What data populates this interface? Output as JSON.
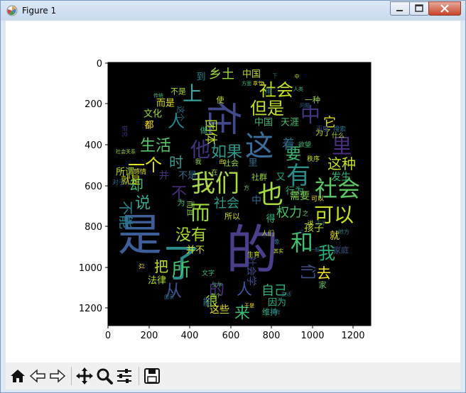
{
  "window": {
    "title": "Figure 1"
  },
  "axes": {
    "x_ticks": [
      "0",
      "200",
      "400",
      "600",
      "800",
      "1000",
      "1200"
    ],
    "y_ticks": [
      "0",
      "200",
      "400",
      "600",
      "800",
      "1000",
      "1200"
    ]
  },
  "wordcloud": [
    {
      "t": "的",
      "x": 354,
      "y": 352,
      "s": 74,
      "c": "#4b3f8c",
      "r": 0
    },
    {
      "t": "是",
      "x": 196,
      "y": 330,
      "s": 62,
      "c": "#3e5e9a",
      "r": 0
    },
    {
      "t": "了",
      "x": 255,
      "y": 370,
      "s": 54,
      "c": "#2a8a8b",
      "r": 0
    },
    {
      "t": "在",
      "x": 313,
      "y": 166,
      "s": 50,
      "c": "#434a8c",
      "r": 90
    },
    {
      "t": "这",
      "x": 364,
      "y": 205,
      "s": 40,
      "c": "#3a6f9b",
      "r": 0
    },
    {
      "t": "我们",
      "x": 302,
      "y": 258,
      "s": 34,
      "c": "#a7d94a",
      "r": 0
    },
    {
      "t": "也",
      "x": 380,
      "y": 274,
      "s": 36,
      "c": "#a5db3e",
      "r": 0
    },
    {
      "t": "社会",
      "x": 474,
      "y": 265,
      "s": 32,
      "c": "#5cc863",
      "r": 0
    },
    {
      "t": "有",
      "x": 419,
      "y": 247,
      "s": 34,
      "c": "#2a8d8a",
      "r": 0
    },
    {
      "t": "可以",
      "x": 469,
      "y": 302,
      "s": 28,
      "c": "#c8e020",
      "r": 0
    },
    {
      "t": "和",
      "x": 424,
      "y": 341,
      "s": 32,
      "c": "#43bf71",
      "r": 0
    },
    {
      "t": "而",
      "x": 281,
      "y": 299,
      "s": 28,
      "c": "#9bd93b",
      "r": 0
    },
    {
      "t": "上",
      "x": 270,
      "y": 131,
      "s": 28,
      "c": "#37a7a0",
      "r": 0
    },
    {
      "t": "社会",
      "x": 388,
      "y": 126,
      "s": 24,
      "c": "#c6e121",
      "r": 0
    },
    {
      "t": "中",
      "x": 436,
      "y": 161,
      "s": 28,
      "c": "#463480",
      "r": 0
    },
    {
      "t": "但是",
      "x": 375,
      "y": 152,
      "s": 24,
      "c": "#c1df2a",
      "r": 0
    },
    {
      "t": "里",
      "x": 480,
      "y": 205,
      "s": 28,
      "c": "#4b2f7f",
      "r": 0
    },
    {
      "t": "他",
      "x": 281,
      "y": 210,
      "s": 28,
      "c": "#46337f",
      "r": 0
    },
    {
      "t": "如果",
      "x": 318,
      "y": 214,
      "s": 22,
      "c": "#2f9a8a",
      "r": 0
    },
    {
      "t": "生活",
      "x": 218,
      "y": 205,
      "s": 22,
      "c": "#56c667",
      "r": 0
    },
    {
      "t": "一个",
      "x": 203,
      "y": 232,
      "s": 24,
      "c": "#e0e324",
      "r": 0
    },
    {
      "t": "时",
      "x": 247,
      "y": 228,
      "s": 20,
      "c": "#3a9d90",
      "r": 0
    },
    {
      "t": "人",
      "x": 247,
      "y": 170,
      "s": 24,
      "c": "#25848e",
      "r": 0
    },
    {
      "t": "没有",
      "x": 268,
      "y": 331,
      "s": 22,
      "c": "#aadc32",
      "r": 0
    },
    {
      "t": "所",
      "x": 254,
      "y": 380,
      "s": 26,
      "c": "#4ac16d",
      "r": 0
    },
    {
      "t": "从",
      "x": 243,
      "y": 409,
      "s": 24,
      "c": "#3b518b",
      "r": 0
    },
    {
      "t": "我",
      "x": 459,
      "y": 356,
      "s": 24,
      "c": "#2ab07f",
      "r": 0
    },
    {
      "t": "要",
      "x": 412,
      "y": 217,
      "s": 22,
      "c": "#3fbc73",
      "r": 0
    },
    {
      "t": "这种",
      "x": 480,
      "y": 230,
      "s": 20,
      "c": "#c2df23",
      "r": 0
    },
    {
      "t": "说",
      "x": 200,
      "y": 286,
      "s": 22,
      "c": "#3ba991",
      "r": 0
    },
    {
      "t": "却",
      "x": 191,
      "y": 260,
      "s": 20,
      "c": "#3fbc73",
      "r": 0
    },
    {
      "t": "不能",
      "x": 176,
      "y": 302,
      "s": 20,
      "c": "#25848e",
      "r": 90
    },
    {
      "t": "不",
      "x": 251,
      "y": 272,
      "s": 22,
      "c": "#472c7a",
      "r": 0
    },
    {
      "t": "权力",
      "x": 406,
      "y": 299,
      "s": 18,
      "c": "#4cc26c",
      "r": 0
    },
    {
      "t": "社会",
      "x": 318,
      "y": 286,
      "s": 18,
      "c": "#2b9a8a",
      "r": 0
    },
    {
      "t": "自己",
      "x": 385,
      "y": 409,
      "s": 18,
      "c": "#2fb47c",
      "r": 0
    },
    {
      "t": "去",
      "x": 455,
      "y": 384,
      "s": 20,
      "c": "#fde725",
      "r": 0
    },
    {
      "t": "们",
      "x": 431,
      "y": 382,
      "s": 22,
      "c": "#3d4e8a",
      "r": 90
    },
    {
      "t": "人",
      "x": 343,
      "y": 408,
      "s": 22,
      "c": "#3a539b",
      "r": 0
    },
    {
      "t": "的",
      "x": 304,
      "y": 408,
      "s": 22,
      "c": "#46317e",
      "r": 0
    },
    {
      "t": "来",
      "x": 340,
      "y": 441,
      "s": 22,
      "c": "#3fbc73",
      "r": 0
    },
    {
      "t": "把",
      "x": 226,
      "y": 375,
      "s": 20,
      "c": "#c8e020",
      "r": 0
    },
    {
      "t": "很",
      "x": 297,
      "y": 425,
      "s": 18,
      "c": "#a0da39",
      "r": 0
    },
    {
      "t": "发生",
      "x": 479,
      "y": 249,
      "s": 14,
      "c": "#34b679",
      "r": 0
    },
    {
      "t": "行为",
      "x": 414,
      "y": 269,
      "s": 13,
      "c": "#28ae80",
      "r": 0
    },
    {
      "t": "孩子",
      "x": 441,
      "y": 321,
      "s": 14,
      "c": "#b5de2b",
      "r": 0
    },
    {
      "t": "乡土",
      "x": 311,
      "y": 104,
      "s": 18,
      "c": "#9fda3a",
      "r": 0
    },
    {
      "t": "中国",
      "x": 353,
      "y": 104,
      "s": 13,
      "c": "#b2dd2d",
      "r": 0
    },
    {
      "t": "团体",
      "x": 295,
      "y": 185,
      "s": 18,
      "c": "#b8de29",
      "r": 90
    },
    {
      "t": "它",
      "x": 463,
      "y": 172,
      "s": 18,
      "c": "#e5e419",
      "r": 0
    },
    {
      "t": "着",
      "x": 405,
      "y": 203,
      "s": 18,
      "c": "#2e6e8e",
      "r": 0
    },
    {
      "t": "需要",
      "x": 421,
      "y": 276,
      "s": 14,
      "c": "#7ad151",
      "r": 0
    },
    {
      "t": "社会学",
      "x": 352,
      "y": 381,
      "s": 14,
      "c": "#3e4a89",
      "r": 90
    },
    {
      "t": "因为",
      "x": 389,
      "y": 426,
      "s": 13,
      "c": "#25ab82",
      "r": 0
    },
    {
      "t": "这些",
      "x": 308,
      "y": 436,
      "s": 14,
      "c": "#e1e21f",
      "r": 0
    },
    {
      "t": "法律",
      "x": 220,
      "y": 395,
      "s": 13,
      "c": "#b2dd2d",
      "r": 0
    },
    {
      "t": "就是",
      "x": 183,
      "y": 254,
      "s": 14,
      "c": "#d8e219",
      "r": 0
    },
    {
      "t": "所谓",
      "x": 175,
      "y": 242,
      "s": 13,
      "c": "#c0df25",
      "r": 0
    },
    {
      "t": "文化",
      "x": 214,
      "y": 160,
      "s": 13,
      "c": "#95d840",
      "r": 0
    },
    {
      "t": "而是",
      "x": 232,
      "y": 145,
      "s": 13,
      "c": "#e5e419",
      "r": 0
    },
    {
      "t": "都",
      "x": 209,
      "y": 176,
      "s": 13,
      "c": "#fde725",
      "r": 0
    },
    {
      "t": "中国",
      "x": 370,
      "y": 172,
      "s": 13,
      "c": "#46b66f",
      "r": 0
    },
    {
      "t": "天涯",
      "x": 407,
      "y": 172,
      "s": 13,
      "c": "#4ac16d",
      "r": 0
    },
    {
      "t": "为了",
      "x": 454,
      "y": 186,
      "s": 11,
      "c": "#c8e020",
      "r": 0
    },
    {
      "t": "搜索",
      "x": 477,
      "y": 182,
      "s": 9,
      "c": "#2c728e",
      "r": 0
    },
    {
      "t": "欲望",
      "x": 428,
      "y": 204,
      "s": 9,
      "c": "#3aba76",
      "r": 0
    },
    {
      "t": "秩序",
      "x": 440,
      "y": 224,
      "s": 9,
      "c": "#c8e020",
      "r": 0
    },
    {
      "t": "社群",
      "x": 364,
      "y": 249,
      "s": 11,
      "c": "#90d743",
      "r": 0
    },
    {
      "t": "又",
      "x": 394,
      "y": 249,
      "s": 13,
      "c": "#29af7f",
      "r": 0
    },
    {
      "t": "就",
      "x": 470,
      "y": 332,
      "s": 14,
      "c": "#e7e419",
      "r": 0
    },
    {
      "t": "家庭",
      "x": 479,
      "y": 352,
      "s": 11,
      "c": "#3b528b",
      "r": 0
    },
    {
      "t": "家",
      "x": 453,
      "y": 401,
      "s": 11,
      "c": "#5ec962",
      "r": 0
    },
    {
      "t": "中",
      "x": 360,
      "y": 282,
      "s": 14,
      "c": "#2f6b8e",
      "r": 0
    },
    {
      "t": "得",
      "x": 380,
      "y": 308,
      "s": 13,
      "c": "#35b779",
      "r": 0
    },
    {
      "t": "所以",
      "x": 326,
      "y": 304,
      "s": 11,
      "c": "#d2e21b",
      "r": 0
    },
    {
      "t": "人们",
      "x": 376,
      "y": 329,
      "s": 9,
      "c": "#b5de2b",
      "r": 0
    },
    {
      "t": "并",
      "x": 230,
      "y": 247,
      "s": 14,
      "c": "#46327e",
      "r": 0
    },
    {
      "t": "不是",
      "x": 263,
      "y": 247,
      "s": 13,
      "c": "#31688e",
      "r": 0
    },
    {
      "t": "而且",
      "x": 267,
      "y": 293,
      "s": 11,
      "c": "#8fd744",
      "r": 90
    },
    {
      "t": "并不",
      "x": 274,
      "y": 352,
      "s": 13,
      "c": "#d0e11c",
      "r": 0
    },
    {
      "t": "维持",
      "x": 379,
      "y": 439,
      "s": 11,
      "c": "#2ab07f",
      "r": 0
    },
    {
      "t": "文字",
      "x": 292,
      "y": 385,
      "s": 9,
      "c": "#3dbc74",
      "r": 0
    },
    {
      "t": "不是",
      "x": 250,
      "y": 128,
      "s": 11,
      "c": "#a8db34",
      "r": 0
    },
    {
      "t": "一种",
      "x": 439,
      "y": 140,
      "s": 11,
      "c": "#9bd93c",
      "r": 0
    },
    {
      "t": "这个",
      "x": 253,
      "y": 159,
      "s": 11,
      "c": "#2d708e",
      "r": 90
    },
    {
      "t": "到",
      "x": 282,
      "y": 108,
      "s": 13,
      "c": "#25858e",
      "r": 0
    },
    {
      "t": "能",
      "x": 291,
      "y": 426,
      "s": 13,
      "c": "#2e6f8e",
      "r": 0
    },
    {
      "t": "为",
      "x": 254,
      "y": 285,
      "s": 11,
      "c": "#37b878",
      "r": 0
    },
    {
      "t": "里",
      "x": 355,
      "y": 229,
      "s": 13,
      "c": "#2f6c8e",
      "r": 0
    },
    {
      "t": "社会",
      "x": 324,
      "y": 229,
      "s": 11,
      "c": "#95d840",
      "r": 0
    },
    {
      "t": "用",
      "x": 377,
      "y": 128,
      "s": 11,
      "c": "#2c738e",
      "r": 0
    },
    {
      "t": "使",
      "x": 309,
      "y": 140,
      "s": 11,
      "c": "#c2df23",
      "r": 0
    },
    {
      "t": "生育",
      "x": 356,
      "y": 359,
      "s": 9,
      "c": "#cde11d",
      "r": 0
    },
    {
      "t": "做",
      "x": 286,
      "y": 183,
      "s": 11,
      "c": "#25ab82",
      "r": 0
    },
    {
      "t": "什么",
      "x": 475,
      "y": 191,
      "s": 9,
      "c": "#b2dd2d",
      "r": 0
    },
    {
      "t": "百度",
      "x": 453,
      "y": 182,
      "s": 9,
      "c": "#3b528b",
      "r": 0
    },
    {
      "t": "可以",
      "x": 446,
      "y": 280,
      "s": 9,
      "c": "#fde725",
      "r": 0
    },
    {
      "t": "说",
      "x": 436,
      "y": 315,
      "s": 9,
      "c": "#bddf26",
      "r": 0
    },
    {
      "t": "之",
      "x": 429,
      "y": 301,
      "s": 9,
      "c": "#5ec962",
      "r": 0
    },
    {
      "t": "感情",
      "x": 196,
      "y": 242,
      "s": 9,
      "c": "#e2e418",
      "r": 0
    },
    {
      "t": "对于",
      "x": 166,
      "y": 257,
      "s": 9,
      "c": "#31688e",
      "r": 0
    },
    {
      "t": "社会关系",
      "x": 176,
      "y": 213,
      "s": 7,
      "c": "#9bd93c",
      "r": 0
    },
    {
      "t": "研究",
      "x": 174,
      "y": 184,
      "s": 8,
      "c": "#46327e",
      "r": 90
    },
    {
      "t": "现在",
      "x": 387,
      "y": 439,
      "s": 7,
      "c": "#2a788e",
      "r": 0
    },
    {
      "t": "国家",
      "x": 237,
      "y": 418,
      "s": 7,
      "c": "#31688e",
      "r": 0
    },
    {
      "t": "以",
      "x": 197,
      "y": 374,
      "s": 9,
      "c": "#e8e419",
      "r": 90
    },
    {
      "t": "在",
      "x": 301,
      "y": 243,
      "s": 9,
      "c": "#a0da39",
      "r": 0
    },
    {
      "t": "我",
      "x": 278,
      "y": 228,
      "s": 9,
      "c": "#8fd744",
      "r": 0
    },
    {
      "t": "由",
      "x": 311,
      "y": 227,
      "s": 7,
      "c": "#fde725",
      "r": 0
    },
    {
      "t": "方",
      "x": 346,
      "y": 264,
      "s": 8,
      "c": "#5ec962",
      "r": 0
    },
    {
      "t": "之",
      "x": 292,
      "y": 264,
      "s": 8,
      "c": "#d8e219",
      "r": 0
    },
    {
      "t": "地方",
      "x": 483,
      "y": 326,
      "s": 8,
      "c": "#2a788e",
      "r": 0
    },
    {
      "t": "其实",
      "x": 391,
      "y": 353,
      "s": 7,
      "c": "#d0e11c",
      "r": 0
    },
    {
      "t": "象",
      "x": 389,
      "y": 340,
      "s": 8,
      "c": "#2c738e",
      "r": 0
    },
    {
      "t": "每个",
      "x": 303,
      "y": 416,
      "s": 7,
      "c": "#95d840",
      "r": 0
    },
    {
      "t": "文字",
      "x": 305,
      "y": 401,
      "s": 7,
      "c": "#46b66f",
      "r": 0
    },
    {
      "t": "于是",
      "x": 350,
      "y": 430,
      "s": 7,
      "c": "#fde725",
      "r": 0
    },
    {
      "t": "生活",
      "x": 402,
      "y": 414,
      "s": 7,
      "c": "#2c738e",
      "r": 0
    },
    {
      "t": "可",
      "x": 423,
      "y": 327,
      "s": 7,
      "c": "#3b528b",
      "r": 0
    },
    {
      "t": "问题",
      "x": 428,
      "y": 148,
      "s": 7,
      "c": "#2f6c8e",
      "r": 0
    },
    {
      "t": "中",
      "x": 417,
      "y": 107,
      "s": 7,
      "c": "#d8e219",
      "r": 0
    },
    {
      "t": "人类",
      "x": 419,
      "y": 125,
      "s": 7,
      "c": "#37b878",
      "r": 0
    },
    {
      "t": "章节",
      "x": 362,
      "y": 117,
      "s": 7,
      "c": "#e8e419",
      "r": 0
    },
    {
      "t": "下",
      "x": 386,
      "y": 106,
      "s": 7,
      "c": "#2a788e",
      "r": 0
    },
    {
      "t": "方面",
      "x": 346,
      "y": 117,
      "s": 7,
      "c": "#3dbc74",
      "r": 0
    },
    {
      "t": "传统",
      "x": 222,
      "y": 134,
      "s": 7,
      "c": "#35b779",
      "r": 0
    },
    {
      "t": "一般",
      "x": 442,
      "y": 351,
      "s": 7,
      "c": "#31688e",
      "r": 0
    },
    {
      "t": "天下",
      "x": 451,
      "y": 314,
      "s": 7,
      "c": "#2a788e",
      "r": 0
    }
  ]
}
